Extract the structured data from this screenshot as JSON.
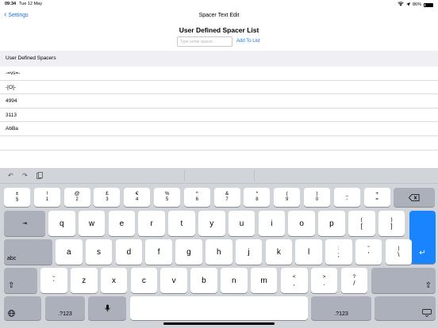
{
  "status": {
    "time": "09:34",
    "date": "Tue 12 May",
    "battery": "86%"
  },
  "nav": {
    "back_label": "Settings",
    "title": "Spacer Text Edit"
  },
  "page": {
    "heading": "User Defined Spacer List",
    "input_placeholder": "Type some spacer...",
    "add_label": "Add To List"
  },
  "section": {
    "header": "User Defined Spacers"
  },
  "spacers": [
    "-=vs=-",
    "-[O]-",
    "4994",
    "3113",
    "AbBa"
  ],
  "keyboard": {
    "row1": [
      {
        "top": "±",
        "bottom": "§"
      },
      {
        "top": "!",
        "bottom": "1"
      },
      {
        "top": "@",
        "bottom": "2"
      },
      {
        "top": "£",
        "bottom": "3"
      },
      {
        "top": "€",
        "bottom": "4"
      },
      {
        "top": "%",
        "bottom": "5"
      },
      {
        "top": "^",
        "bottom": "6"
      },
      {
        "top": "&",
        "bottom": "7"
      },
      {
        "top": "*",
        "bottom": "8"
      },
      {
        "top": "(",
        "bottom": "9"
      },
      {
        "top": ")",
        "bottom": "0"
      },
      {
        "top": "_",
        "bottom": "-"
      },
      {
        "top": "+",
        "bottom": "="
      }
    ],
    "row2": [
      "q",
      "w",
      "e",
      "r",
      "t",
      "y",
      "u",
      "i",
      "o",
      "p"
    ],
    "row2_extra": [
      {
        "top": "{",
        "bottom": "["
      },
      {
        "top": "}",
        "bottom": "]"
      }
    ],
    "row3": [
      "a",
      "s",
      "d",
      "f",
      "g",
      "h",
      "j",
      "k",
      "l"
    ],
    "row3_extra": [
      {
        "top": ":",
        "bottom": ";"
      },
      {
        "top": "\"",
        "bottom": "'"
      },
      {
        "top": "|",
        "bottom": "\\"
      }
    ],
    "row4": [
      "z",
      "x",
      "c",
      "v",
      "b",
      "n",
      "m"
    ],
    "row4_first": {
      "top": "~",
      "bottom": "`"
    },
    "row4_extra": [
      {
        "top": "<",
        "bottom": ","
      },
      {
        "top": ">",
        "bottom": "."
      },
      {
        "top": "?",
        "bottom": "/"
      }
    ],
    "tab_label": "⇥",
    "caps_label": "abc",
    "numbers_label": ".?123",
    "numbers_label_right": ".?123"
  },
  "colors": {
    "accent": "#1a73e8",
    "key_return": "#1a84ff"
  }
}
